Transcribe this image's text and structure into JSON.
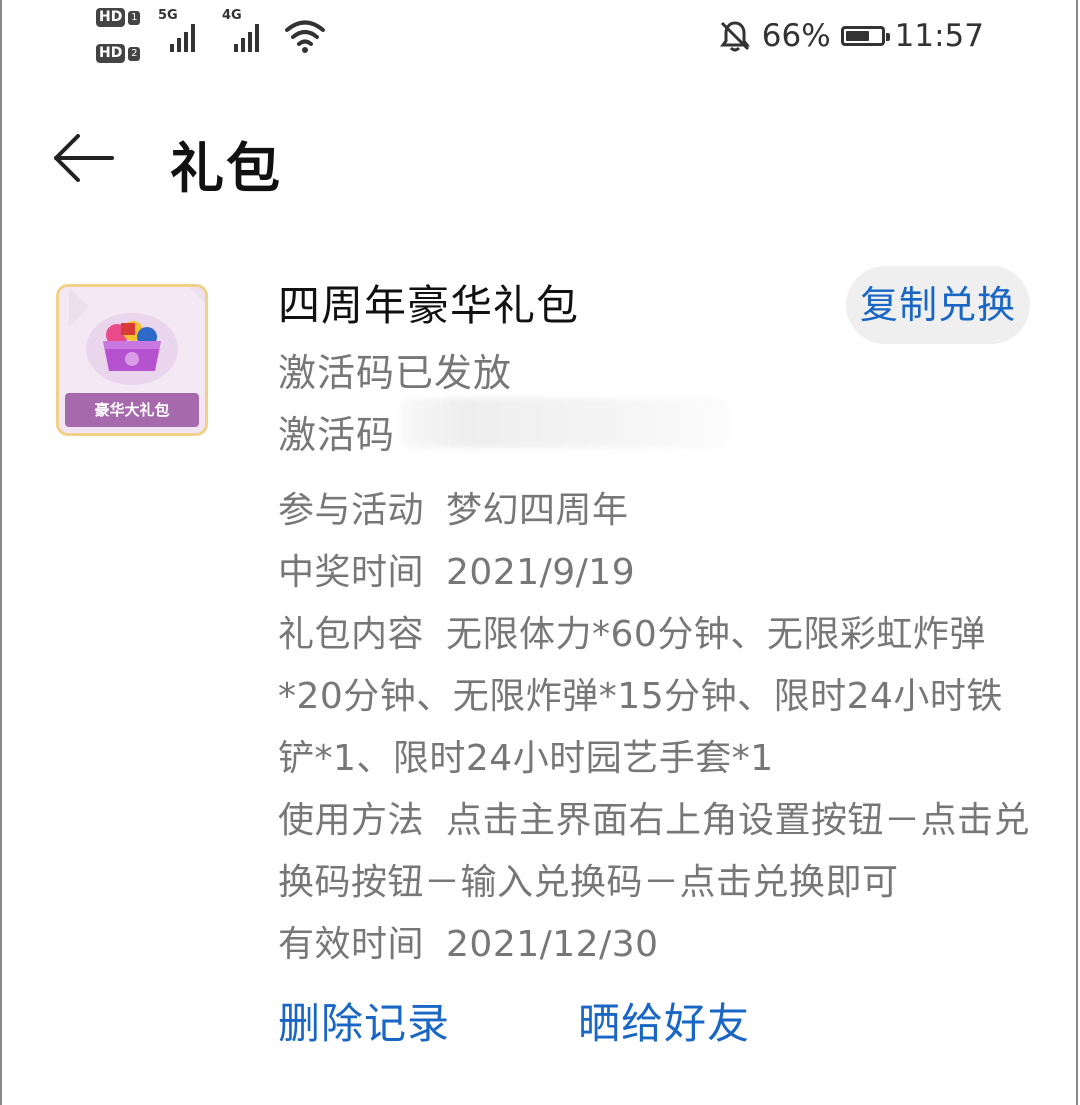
{
  "status_bar": {
    "hd1": "HD",
    "hd1_num": "1",
    "hd2": "HD",
    "hd2_num": "2",
    "net1": "5G",
    "net2": "4G",
    "battery_percent": "66%",
    "battery_level": 0.66,
    "time": "11:57",
    "icons": [
      "signal-5g-icon",
      "signal-4g-icon",
      "wifi-icon",
      "bell-muted-icon",
      "battery-icon"
    ]
  },
  "header": {
    "title": "礼包",
    "back_icon": "arrow-left-icon"
  },
  "gift": {
    "thumbnail_label": "豪华大礼包",
    "name": "四周年豪华礼包",
    "status": "激活码已发放",
    "code_label": "激活码",
    "copy_button": "复制兑换",
    "details": [
      {
        "key": "参与活动",
        "value": "梦幻四周年"
      },
      {
        "key": "中奖时间",
        "value": "2021/9/19"
      },
      {
        "key": "礼包内容",
        "value": "无限体力*60分钟、无限彩虹炸弹*20分钟、无限炸弹*15分钟、限时24小时铁铲*1、限时24小时园艺手套*1"
      },
      {
        "key": "使用方法",
        "value": "点击主界面右上角设置按钮－点击兑换码按钮－输入兑换码－点击兑换即可"
      },
      {
        "key": "有效时间",
        "value": "2021/12/30"
      }
    ]
  },
  "actions": {
    "delete": "删除记录",
    "share": "晒给好友"
  },
  "colors": {
    "accent": "#1966c4",
    "secondary_text": "#777777",
    "button_bg": "#efefef"
  }
}
